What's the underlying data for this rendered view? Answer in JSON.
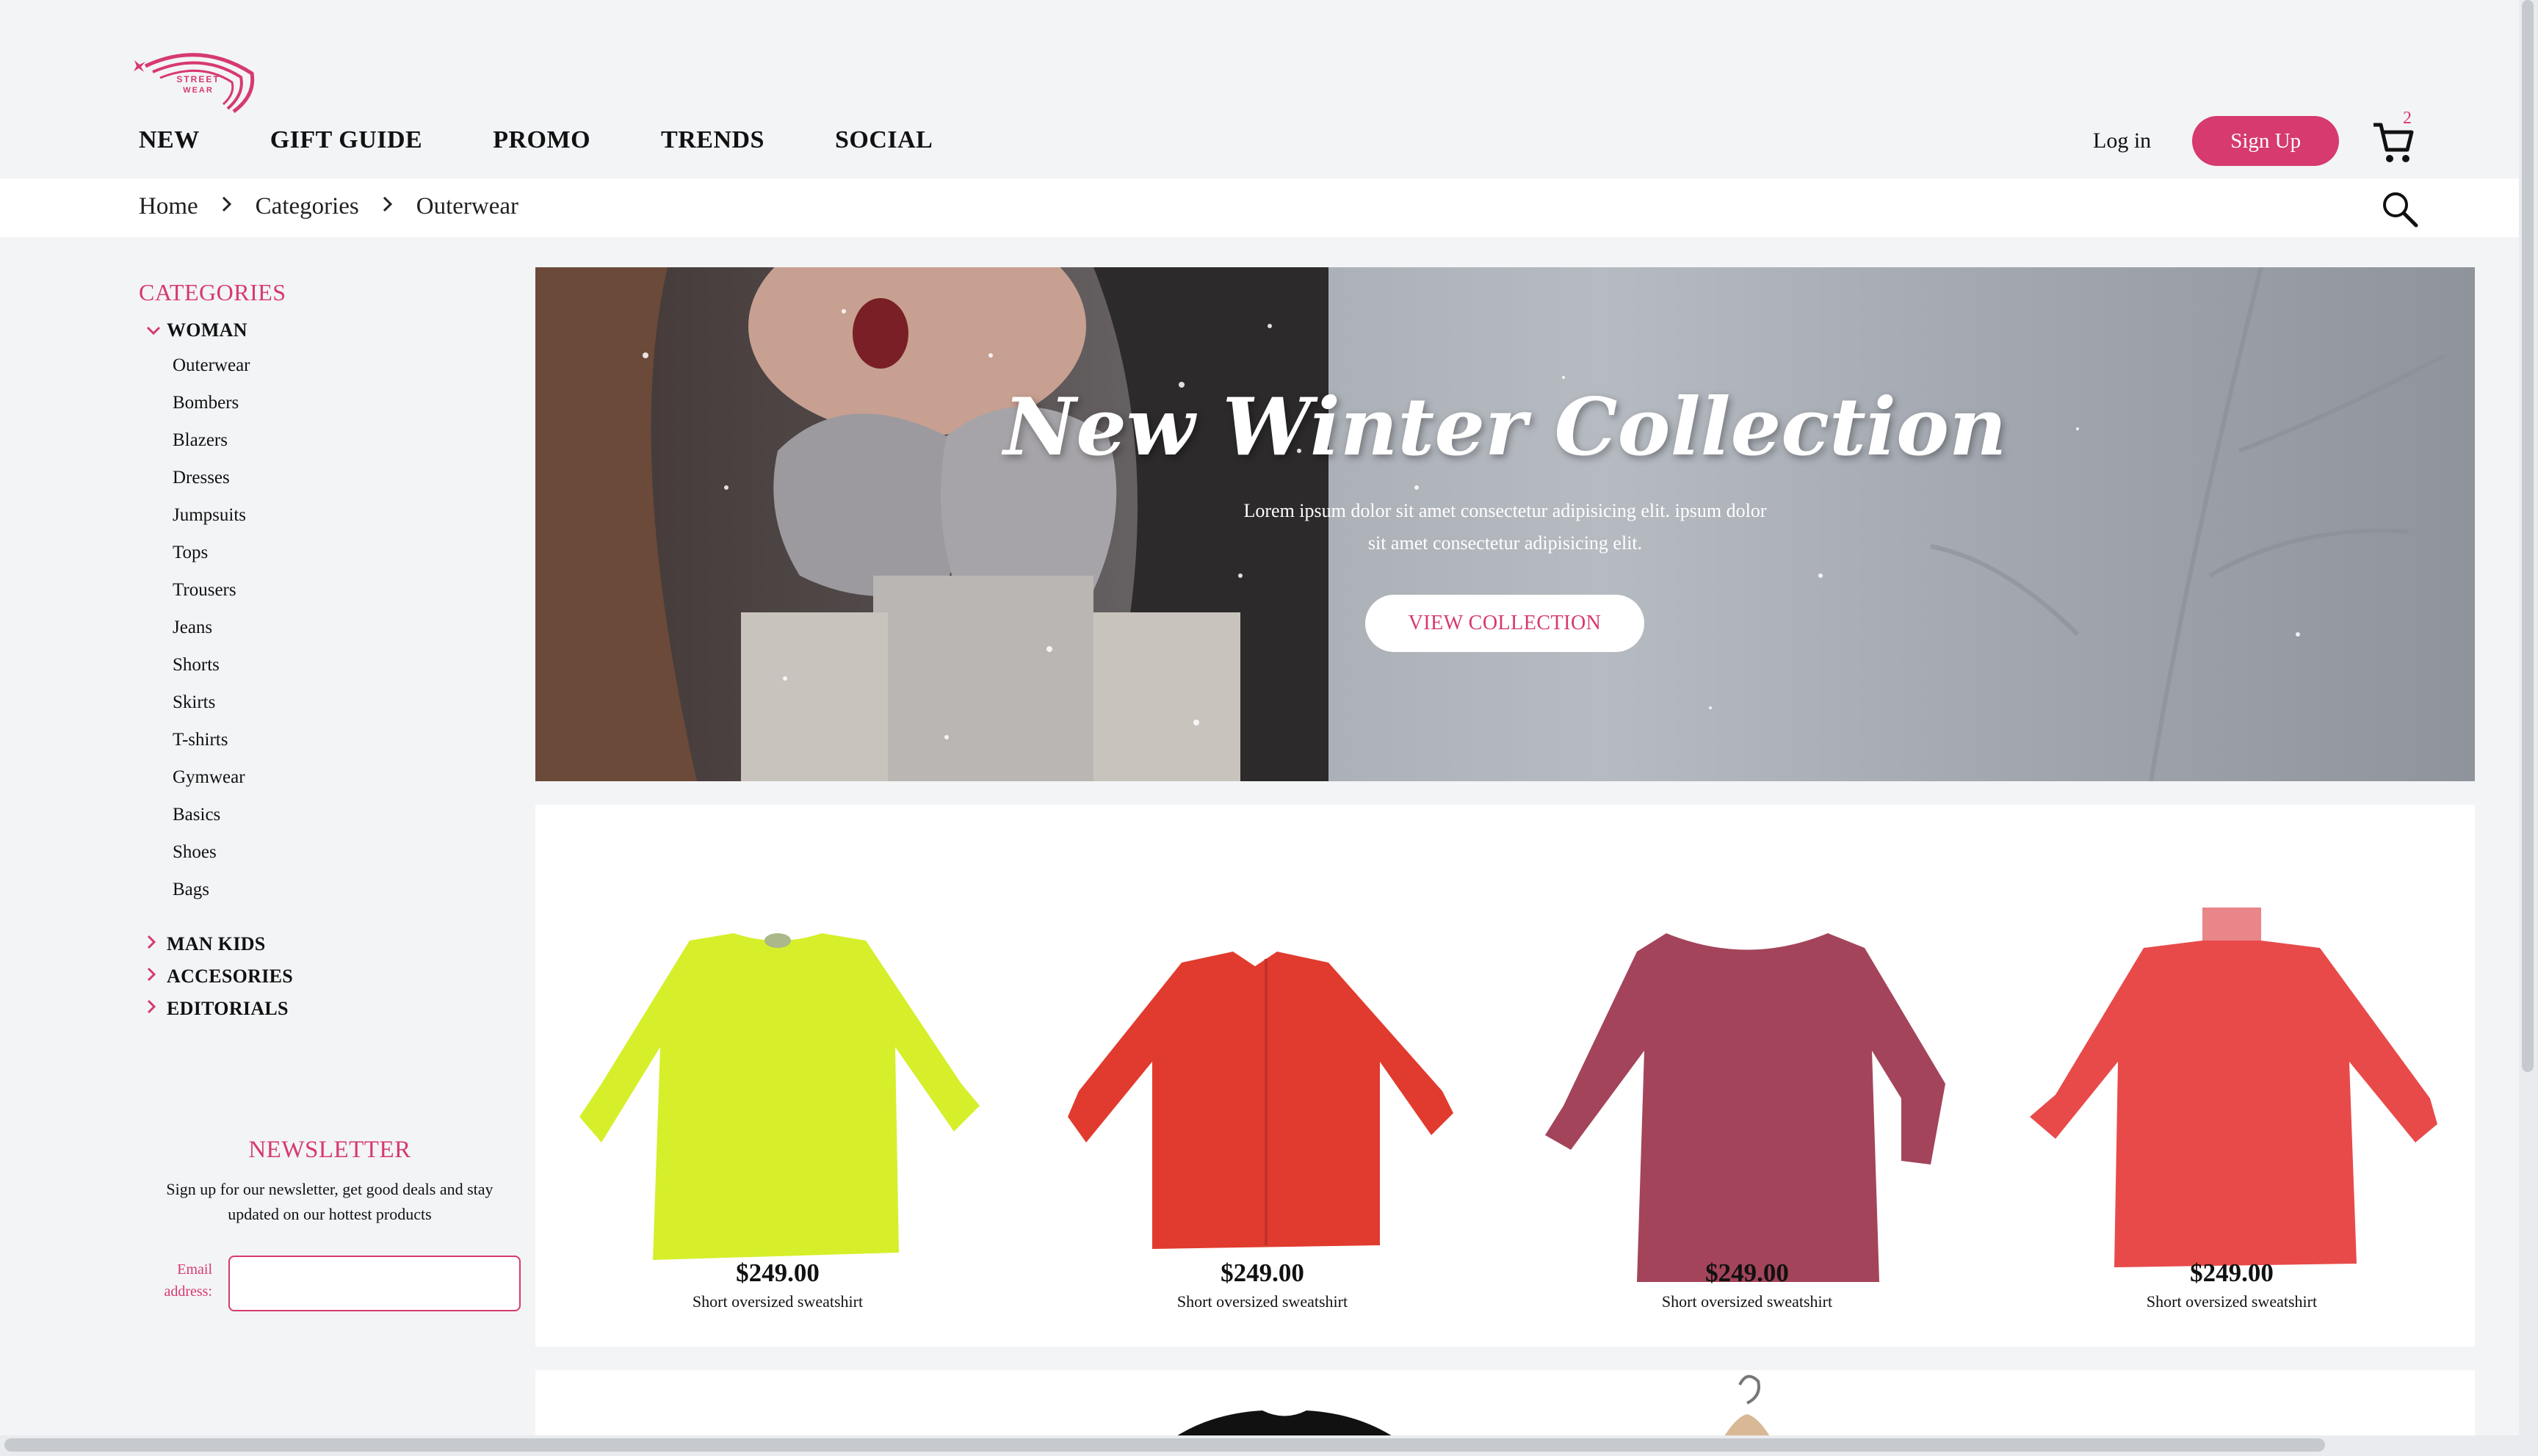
{
  "brand": {
    "logo_text_line1": "STREET",
    "logo_text_line2": "WEAR"
  },
  "colors": {
    "accent": "#d63a6e",
    "background": "#f3f4f6"
  },
  "nav": {
    "items": [
      {
        "label": "NEW"
      },
      {
        "label": "GIFT GUIDE"
      },
      {
        "label": "PROMO"
      },
      {
        "label": "TRENDS"
      },
      {
        "label": "SOCIAL"
      }
    ]
  },
  "auth": {
    "login_label": "Log in",
    "signup_label": "Sign Up"
  },
  "cart": {
    "icon": "cart-icon",
    "count": "2"
  },
  "breadcrumb": {
    "items": [
      "Home",
      "Categories",
      "Outerwear"
    ],
    "separator_icon": "chevron-right-icon"
  },
  "search": {
    "icon": "search-icon"
  },
  "sidebar": {
    "title": "CATEGORIES",
    "woman": {
      "label": "WOMAN",
      "items": [
        "Outerwear",
        "Bombers",
        "Blazers",
        "Dresses",
        "Jumpsuits",
        "Tops",
        "Trousers",
        "Jeans",
        "Shorts",
        "Skirts",
        "T-shirts",
        "Gymwear",
        "Basics",
        "Shoes",
        "Bags"
      ]
    },
    "groups": [
      {
        "label": "MAN KIDS"
      },
      {
        "label": "ACCESORIES"
      },
      {
        "label": "EDITORIALS"
      }
    ]
  },
  "newsletter": {
    "title": "NEWSLETTER",
    "text": "Sign up for our newsletter, get good deals and stay updated on our hottest products",
    "email_label": "Email address:",
    "email_value": ""
  },
  "hero": {
    "title": "New Winter Collection",
    "subtitle_line1": "Lorem ipsum dolor sit amet consectetur adipisicing elit. ipsum dolor",
    "subtitle_line2": "sit amet consectetur adipisicing elit.",
    "button_label": "VIEW COLLECTION"
  },
  "products": [
    {
      "price": "$249.00",
      "name": "Short oversized sweatshirt",
      "color": "#d6ef2a"
    },
    {
      "price": "$249.00",
      "name": "Short oversized sweatshirt",
      "color": "#e03b2e"
    },
    {
      "price": "$249.00",
      "name": "Short oversized sweatshirt",
      "color": "#a3445a"
    },
    {
      "price": "$249.00",
      "name": "Short oversized sweatshirt",
      "color": "#e84a4a"
    }
  ]
}
